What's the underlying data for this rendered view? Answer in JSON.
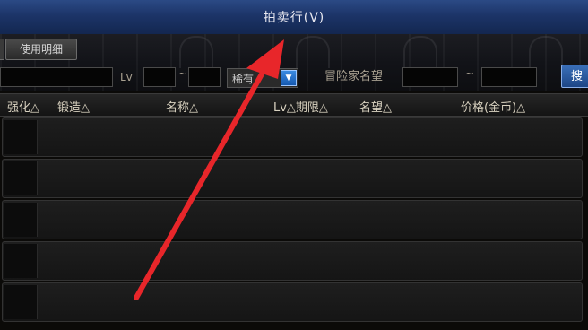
{
  "window": {
    "title": "拍卖行(V)"
  },
  "toolbar": {
    "usage_detail_label": "使用明细"
  },
  "filters": {
    "lv_label": "Lv",
    "tilde": "~",
    "rarity_label": "稀有",
    "adventurer_label": "冒险家名望",
    "search_label": "搜"
  },
  "columns": {
    "enhance": "强化△",
    "forge": "锻造△",
    "name": "名称△",
    "lv_period": "Lv△期限△",
    "fame": "名望△",
    "price": "价格(金币)△"
  },
  "rows": [
    "",
    "",
    "",
    "",
    ""
  ],
  "colors": {
    "annotation_arrow": "#e8262a",
    "titlebar": "#1c3468",
    "dropdown": "#1659b0"
  }
}
